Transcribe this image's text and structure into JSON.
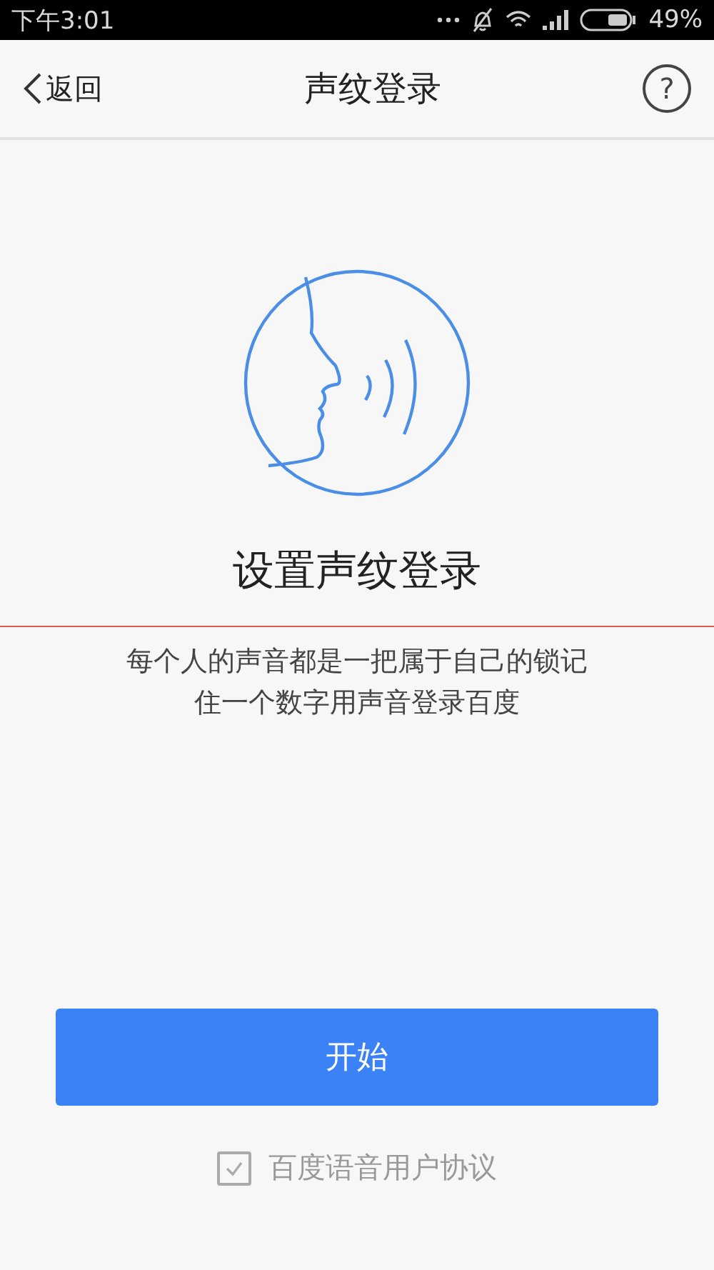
{
  "status_bar": {
    "time": "下午3:01",
    "battery": "49%"
  },
  "nav": {
    "back": "返回",
    "title": "声纹登录",
    "help": "?"
  },
  "heading": "设置声纹登录",
  "description": "每个人的声音都是一把属于自己的锁记住一个数字用声音登录百度",
  "start_button": "开始",
  "agreement": {
    "label": "百度语音用户协议",
    "checked": true
  }
}
